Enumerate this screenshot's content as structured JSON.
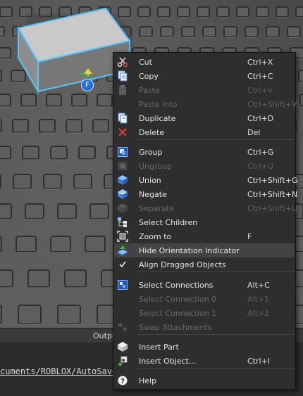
{
  "viewport": {
    "pivot_label": "F",
    "colors": {
      "selection": "#58c3ff",
      "part": "#c4c4c4",
      "pivot": "#1e6fe0"
    }
  },
  "output_panel": {
    "title": "Outpu",
    "log_line": "cuments/ROBLOX/AutoSave"
  },
  "context_menu": {
    "items": [
      {
        "label": "Cut",
        "shortcut": "Ctrl+X",
        "icon": "scissors-icon",
        "enabled": true
      },
      {
        "label": "Copy",
        "shortcut": "Ctrl+C",
        "icon": "copy-icon",
        "enabled": true
      },
      {
        "label": "Paste",
        "shortcut": "Ctrl+V",
        "icon": "clipboard-icon",
        "enabled": false
      },
      {
        "label": "Paste Into",
        "shortcut": "Ctrl+Shift+V",
        "icon": "",
        "enabled": false
      },
      {
        "label": "Duplicate",
        "shortcut": "Ctrl+D",
        "icon": "duplicate-icon",
        "enabled": true
      },
      {
        "label": "Delete",
        "shortcut": "Del",
        "icon": "delete-x-icon",
        "enabled": true
      },
      {
        "label": "Group",
        "shortcut": "Ctrl+G",
        "icon": "group-icon",
        "enabled": true
      },
      {
        "label": "Ungroup",
        "shortcut": "Ctrl+U",
        "icon": "ungroup-icon",
        "enabled": false
      },
      {
        "label": "Union",
        "shortcut": "Ctrl+Shift+G",
        "icon": "union-icon",
        "enabled": true
      },
      {
        "label": "Negate",
        "shortcut": "Ctrl+Shift+N",
        "icon": "negate-icon",
        "enabled": true
      },
      {
        "label": "Separate",
        "shortcut": "Ctrl+Shift+U",
        "icon": "separate-icon",
        "enabled": false
      },
      {
        "label": "Select Children",
        "shortcut": "",
        "icon": "select-children-icon",
        "enabled": true
      },
      {
        "label": "Zoom to",
        "shortcut": "F",
        "icon": "zoom-to-icon",
        "enabled": true
      },
      {
        "label": "Hide Orientation Indicator",
        "shortcut": "",
        "icon": "orientation-indicator-icon",
        "enabled": true,
        "highlighted": true
      },
      {
        "label": "Align Dragged Objects",
        "shortcut": "",
        "icon": "checkmark-icon",
        "enabled": true,
        "checked": true
      },
      {
        "label": "Select Connections",
        "shortcut": "Alt+C",
        "icon": "select-connections-icon",
        "enabled": true
      },
      {
        "label": "Select Connection 0",
        "shortcut": "Alt+1",
        "icon": "",
        "enabled": false
      },
      {
        "label": "Select Connection 1",
        "shortcut": "Alt+2",
        "icon": "",
        "enabled": false
      },
      {
        "label": "Swap Attachments",
        "shortcut": "",
        "icon": "swap-attachments-icon",
        "enabled": false
      },
      {
        "label": "Insert Part",
        "shortcut": "",
        "icon": "insert-part-icon",
        "enabled": true
      },
      {
        "label": "Insert Object...",
        "shortcut": "Ctrl+I",
        "icon": "insert-object-icon",
        "enabled": true
      },
      {
        "label": "Help",
        "shortcut": "",
        "icon": "help-icon",
        "enabled": true
      }
    ]
  }
}
